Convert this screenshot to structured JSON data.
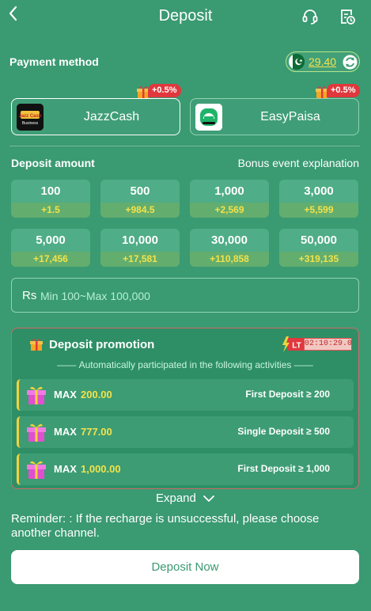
{
  "header": {
    "title": "Deposit",
    "back_icon": "chevron-left-icon",
    "support_icon": "headset-icon",
    "history_icon": "records-clock-icon"
  },
  "payment": {
    "label": "Payment method",
    "balance": "29.40",
    "balance_flag": "pakistan-flag-icon",
    "refresh_icon": "refresh-icon",
    "methods": [
      {
        "name": "JazzCash",
        "logo_line1": "Jazz Cash",
        "logo_line2": "Business",
        "bonus": "+0.5%",
        "selected": true
      },
      {
        "name": "EasyPaisa",
        "bonus": "+0.5%",
        "selected": false
      }
    ]
  },
  "deposit": {
    "label": "Deposit amount",
    "bonus_explanation": "Bonus event explanation",
    "amounts": [
      {
        "value": "100",
        "bonus": "+1.5"
      },
      {
        "value": "500",
        "bonus": "+984.5"
      },
      {
        "value": "1,000",
        "bonus": "+2,569"
      },
      {
        "value": "3,000",
        "bonus": "+5,599"
      },
      {
        "value": "5,000",
        "bonus": "+17,456"
      },
      {
        "value": "10,000",
        "bonus": "+17,581"
      },
      {
        "value": "30,000",
        "bonus": "+110,858"
      },
      {
        "value": "50,000",
        "bonus": "+319,135"
      }
    ],
    "currency": "Rs",
    "input_placeholder": "Min 100~Max 100,000"
  },
  "promotion": {
    "title": "Deposit promotion",
    "badge": "LT",
    "timer": "02:10:29.0",
    "subtitle": "Automatically participated in the following activities",
    "rows": [
      {
        "max_label": "MAX",
        "max_value": "200.00",
        "condition": "First Deposit ≥ 200"
      },
      {
        "max_label": "MAX",
        "max_value": "777.00",
        "condition": "Single Deposit ≥ 500"
      },
      {
        "max_label": "MAX",
        "max_value": "1,000.00",
        "condition": "First Deposit ≥ 1,000"
      }
    ]
  },
  "expand_label": "Expand",
  "reminder": "Reminder: :  If the recharge is unsuccessful, please choose another channel.",
  "deposit_button": "Deposit Now",
  "colors": {
    "background": "#3a9a72",
    "bonus_yellow": "#f3e24a",
    "bonus_tag_red": "#e0383d"
  }
}
